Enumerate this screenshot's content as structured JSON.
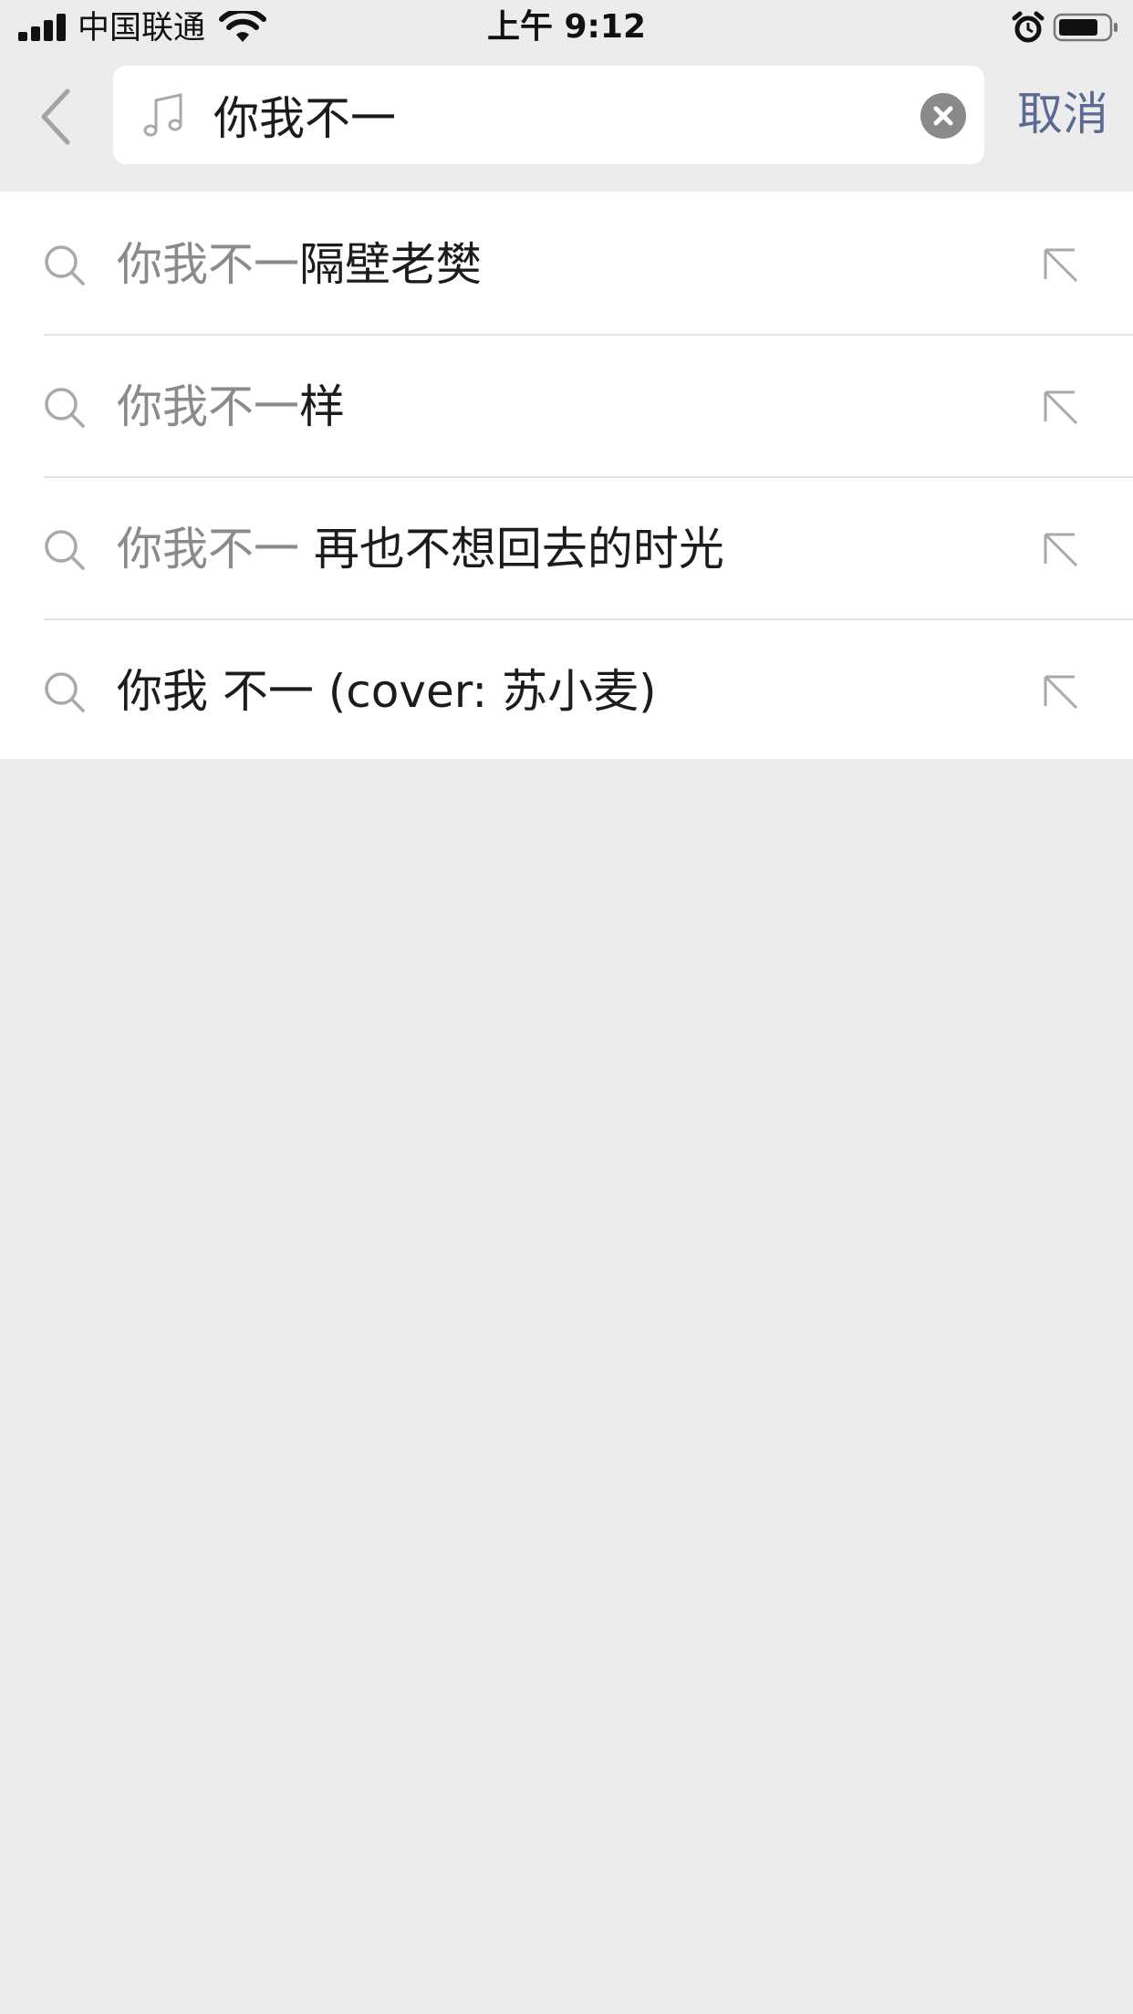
{
  "status_bar": {
    "carrier": "中国联通",
    "time": "上午 9:12"
  },
  "search": {
    "query": "你我不一",
    "cancel_label": "取消"
  },
  "suggestions": [
    {
      "match": "你我不一",
      "rest": "隔壁老樊"
    },
    {
      "match": "你我不一",
      "rest": "样"
    },
    {
      "match": "你我不一",
      "rest": " 再也不想回去的时光"
    },
    {
      "match": "",
      "rest": "你我 不一 (cover: 苏小麦)"
    }
  ],
  "colors": {
    "background": "#ececec",
    "accent": "#5a6a92",
    "matched_text": "#8b8b8b"
  }
}
